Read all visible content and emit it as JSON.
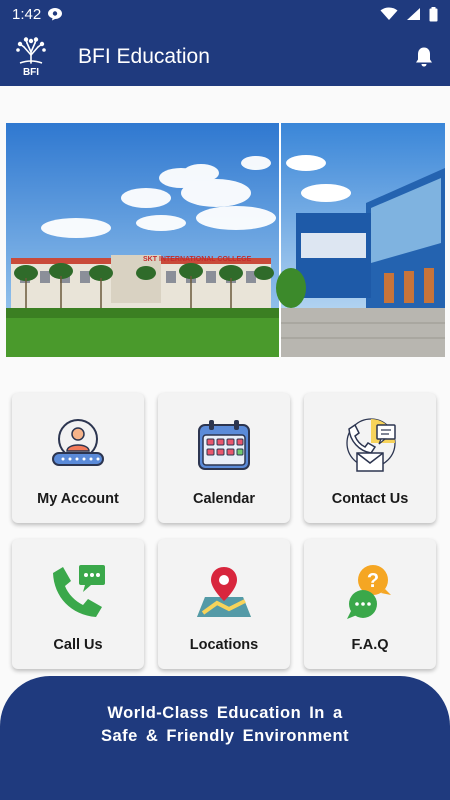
{
  "status_bar": {
    "time": "1:42"
  },
  "app_bar": {
    "title": "BFI Education",
    "logo_text": "BFI"
  },
  "banner": {
    "building_sign": "SKT INTERNATIONAL COLLEGE"
  },
  "tiles": [
    {
      "label": "My Account",
      "icon": "user-account-icon"
    },
    {
      "label": "Calendar",
      "icon": "calendar-icon"
    },
    {
      "label": "Contact Us",
      "icon": "contact-us-icon"
    },
    {
      "label": "Call Us",
      "icon": "phone-chat-icon"
    },
    {
      "label": "Locations",
      "icon": "map-pin-icon"
    },
    {
      "label": "F.A.Q",
      "icon": "faq-icon"
    }
  ],
  "footer": {
    "line1": "World-Class Education In a",
    "line2": "Safe & Friendly Environment"
  },
  "colors": {
    "brand": "#1f3a7e",
    "tile_bg": "#f3f3f3"
  }
}
